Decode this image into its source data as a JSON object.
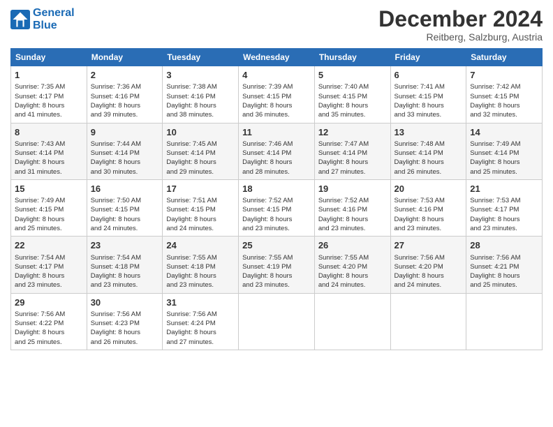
{
  "header": {
    "logo_line1": "General",
    "logo_line2": "Blue",
    "month_title": "December 2024",
    "subtitle": "Reitberg, Salzburg, Austria"
  },
  "days_of_week": [
    "Sunday",
    "Monday",
    "Tuesday",
    "Wednesday",
    "Thursday",
    "Friday",
    "Saturday"
  ],
  "weeks": [
    [
      {
        "day": "1",
        "lines": [
          "Sunrise: 7:35 AM",
          "Sunset: 4:17 PM",
          "Daylight: 8 hours",
          "and 41 minutes."
        ]
      },
      {
        "day": "2",
        "lines": [
          "Sunrise: 7:36 AM",
          "Sunset: 4:16 PM",
          "Daylight: 8 hours",
          "and 39 minutes."
        ]
      },
      {
        "day": "3",
        "lines": [
          "Sunrise: 7:38 AM",
          "Sunset: 4:16 PM",
          "Daylight: 8 hours",
          "and 38 minutes."
        ]
      },
      {
        "day": "4",
        "lines": [
          "Sunrise: 7:39 AM",
          "Sunset: 4:15 PM",
          "Daylight: 8 hours",
          "and 36 minutes."
        ]
      },
      {
        "day": "5",
        "lines": [
          "Sunrise: 7:40 AM",
          "Sunset: 4:15 PM",
          "Daylight: 8 hours",
          "and 35 minutes."
        ]
      },
      {
        "day": "6",
        "lines": [
          "Sunrise: 7:41 AM",
          "Sunset: 4:15 PM",
          "Daylight: 8 hours",
          "and 33 minutes."
        ]
      },
      {
        "day": "7",
        "lines": [
          "Sunrise: 7:42 AM",
          "Sunset: 4:15 PM",
          "Daylight: 8 hours",
          "and 32 minutes."
        ]
      }
    ],
    [
      {
        "day": "8",
        "lines": [
          "Sunrise: 7:43 AM",
          "Sunset: 4:14 PM",
          "Daylight: 8 hours",
          "and 31 minutes."
        ]
      },
      {
        "day": "9",
        "lines": [
          "Sunrise: 7:44 AM",
          "Sunset: 4:14 PM",
          "Daylight: 8 hours",
          "and 30 minutes."
        ]
      },
      {
        "day": "10",
        "lines": [
          "Sunrise: 7:45 AM",
          "Sunset: 4:14 PM",
          "Daylight: 8 hours",
          "and 29 minutes."
        ]
      },
      {
        "day": "11",
        "lines": [
          "Sunrise: 7:46 AM",
          "Sunset: 4:14 PM",
          "Daylight: 8 hours",
          "and 28 minutes."
        ]
      },
      {
        "day": "12",
        "lines": [
          "Sunrise: 7:47 AM",
          "Sunset: 4:14 PM",
          "Daylight: 8 hours",
          "and 27 minutes."
        ]
      },
      {
        "day": "13",
        "lines": [
          "Sunrise: 7:48 AM",
          "Sunset: 4:14 PM",
          "Daylight: 8 hours",
          "and 26 minutes."
        ]
      },
      {
        "day": "14",
        "lines": [
          "Sunrise: 7:49 AM",
          "Sunset: 4:14 PM",
          "Daylight: 8 hours",
          "and 25 minutes."
        ]
      }
    ],
    [
      {
        "day": "15",
        "lines": [
          "Sunrise: 7:49 AM",
          "Sunset: 4:15 PM",
          "Daylight: 8 hours",
          "and 25 minutes."
        ]
      },
      {
        "day": "16",
        "lines": [
          "Sunrise: 7:50 AM",
          "Sunset: 4:15 PM",
          "Daylight: 8 hours",
          "and 24 minutes."
        ]
      },
      {
        "day": "17",
        "lines": [
          "Sunrise: 7:51 AM",
          "Sunset: 4:15 PM",
          "Daylight: 8 hours",
          "and 24 minutes."
        ]
      },
      {
        "day": "18",
        "lines": [
          "Sunrise: 7:52 AM",
          "Sunset: 4:15 PM",
          "Daylight: 8 hours",
          "and 23 minutes."
        ]
      },
      {
        "day": "19",
        "lines": [
          "Sunrise: 7:52 AM",
          "Sunset: 4:16 PM",
          "Daylight: 8 hours",
          "and 23 minutes."
        ]
      },
      {
        "day": "20",
        "lines": [
          "Sunrise: 7:53 AM",
          "Sunset: 4:16 PM",
          "Daylight: 8 hours",
          "and 23 minutes."
        ]
      },
      {
        "day": "21",
        "lines": [
          "Sunrise: 7:53 AM",
          "Sunset: 4:17 PM",
          "Daylight: 8 hours",
          "and 23 minutes."
        ]
      }
    ],
    [
      {
        "day": "22",
        "lines": [
          "Sunrise: 7:54 AM",
          "Sunset: 4:17 PM",
          "Daylight: 8 hours",
          "and 23 minutes."
        ]
      },
      {
        "day": "23",
        "lines": [
          "Sunrise: 7:54 AM",
          "Sunset: 4:18 PM",
          "Daylight: 8 hours",
          "and 23 minutes."
        ]
      },
      {
        "day": "24",
        "lines": [
          "Sunrise: 7:55 AM",
          "Sunset: 4:18 PM",
          "Daylight: 8 hours",
          "and 23 minutes."
        ]
      },
      {
        "day": "25",
        "lines": [
          "Sunrise: 7:55 AM",
          "Sunset: 4:19 PM",
          "Daylight: 8 hours",
          "and 23 minutes."
        ]
      },
      {
        "day": "26",
        "lines": [
          "Sunrise: 7:55 AM",
          "Sunset: 4:20 PM",
          "Daylight: 8 hours",
          "and 24 minutes."
        ]
      },
      {
        "day": "27",
        "lines": [
          "Sunrise: 7:56 AM",
          "Sunset: 4:20 PM",
          "Daylight: 8 hours",
          "and 24 minutes."
        ]
      },
      {
        "day": "28",
        "lines": [
          "Sunrise: 7:56 AM",
          "Sunset: 4:21 PM",
          "Daylight: 8 hours",
          "and 25 minutes."
        ]
      }
    ],
    [
      {
        "day": "29",
        "lines": [
          "Sunrise: 7:56 AM",
          "Sunset: 4:22 PM",
          "Daylight: 8 hours",
          "and 25 minutes."
        ]
      },
      {
        "day": "30",
        "lines": [
          "Sunrise: 7:56 AM",
          "Sunset: 4:23 PM",
          "Daylight: 8 hours",
          "and 26 minutes."
        ]
      },
      {
        "day": "31",
        "lines": [
          "Sunrise: 7:56 AM",
          "Sunset: 4:24 PM",
          "Daylight: 8 hours",
          "and 27 minutes."
        ]
      },
      {
        "day": "",
        "lines": []
      },
      {
        "day": "",
        "lines": []
      },
      {
        "day": "",
        "lines": []
      },
      {
        "day": "",
        "lines": []
      }
    ]
  ]
}
